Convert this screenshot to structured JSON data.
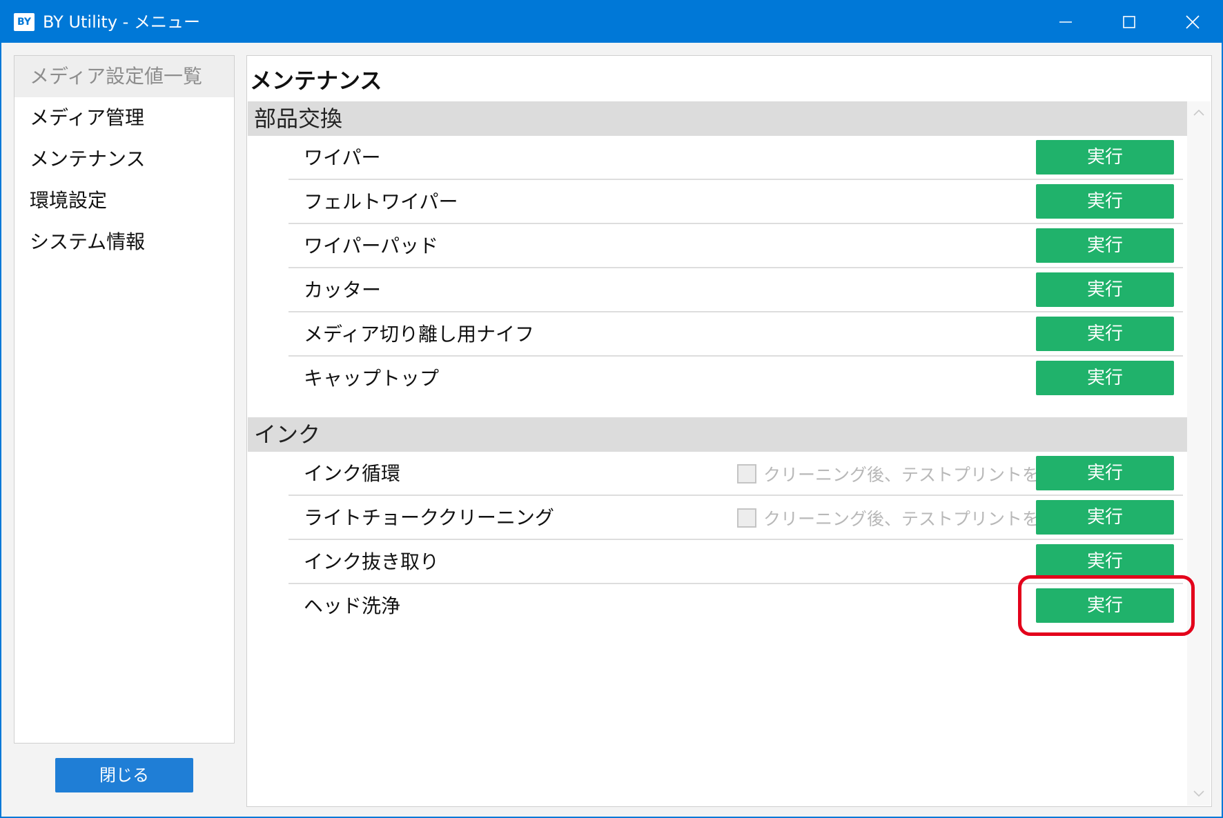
{
  "window": {
    "icon_text": "BY",
    "title": "BY Utility - メニュー",
    "controls": {
      "minimize": "minimize-icon",
      "maximize": "maximize-icon",
      "close": "close-icon"
    }
  },
  "sidebar": {
    "items": [
      {
        "label": "メディア設定値一覧",
        "active": true
      },
      {
        "label": "メディア管理",
        "active": false
      },
      {
        "label": "メンテナンス",
        "active": false
      },
      {
        "label": "環境設定",
        "active": false
      },
      {
        "label": "システム情報",
        "active": false
      }
    ],
    "close_label": "閉じる"
  },
  "main": {
    "title": "メンテナンス",
    "sections": [
      {
        "header": "部品交換",
        "rows": [
          {
            "label": "ワイパー",
            "button": "実行"
          },
          {
            "label": "フェルトワイパー",
            "button": "実行"
          },
          {
            "label": "ワイパーパッド",
            "button": "実行"
          },
          {
            "label": "カッター",
            "button": "実行"
          },
          {
            "label": "メディア切り離し用ナイフ",
            "button": "実行"
          },
          {
            "label": "キャップトップ",
            "button": "実行"
          }
        ]
      },
      {
        "header": "インク",
        "rows": [
          {
            "label": "インク循環",
            "option": "クリーニング後、テストプリントを行う",
            "option_checked": false,
            "button": "実行"
          },
          {
            "label": "ライトチョーククリーニング",
            "option": "クリーニング後、テストプリントを行う",
            "option_checked": false,
            "button": "実行"
          },
          {
            "label": "インク抜き取り",
            "button": "実行"
          },
          {
            "label": "ヘッド洗浄",
            "button": "実行"
          }
        ]
      }
    ]
  },
  "colors": {
    "titlebar": "#0078d7",
    "exec_button": "#20b26b",
    "close_button": "#1f7ed6",
    "highlight": "#e3001b"
  }
}
